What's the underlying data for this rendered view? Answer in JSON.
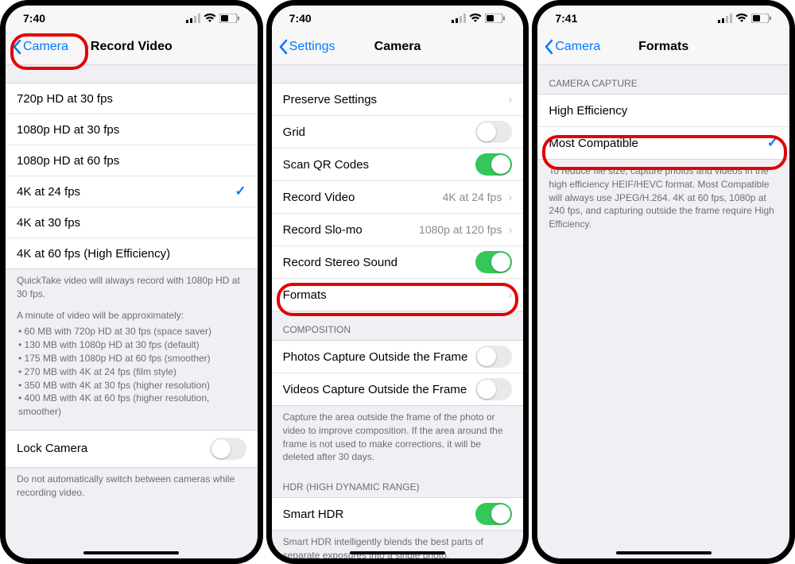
{
  "phone1": {
    "time": "7:40",
    "back": "Camera",
    "title": "Record Video",
    "options": [
      {
        "label": "720p HD at 30 fps",
        "selected": false
      },
      {
        "label": "1080p HD at 30 fps",
        "selected": false
      },
      {
        "label": "1080p HD at 60 fps",
        "selected": false
      },
      {
        "label": "4K at 24 fps",
        "selected": true
      },
      {
        "label": "4K at 30 fps",
        "selected": false
      },
      {
        "label": "4K at 60 fps (High Efficiency)",
        "selected": false
      }
    ],
    "footer_top": "QuickTake video will always record with 1080p HD at 30 fps.",
    "footer_intro": "A minute of video will be approximately:",
    "footer_bullets": [
      "60 MB with 720p HD at 30 fps (space saver)",
      "130 MB with 1080p HD at 30 fps (default)",
      "175 MB with 1080p HD at 60 fps (smoother)",
      "270 MB with 4K at 24 fps (film style)",
      "350 MB with 4K at 30 fps (higher resolution)",
      "400 MB with 4K at 60 fps (higher resolution, smoother)"
    ],
    "lock_label": "Lock Camera",
    "lock_footer": "Do not automatically switch between cameras while recording video."
  },
  "phone2": {
    "time": "7:40",
    "back": "Settings",
    "title": "Camera",
    "rows": {
      "preserve": "Preserve Settings",
      "grid": "Grid",
      "scanqr": "Scan QR Codes",
      "recvid": "Record Video",
      "recvid_val": "4K at 24 fps",
      "recslo": "Record Slo-mo",
      "recslo_val": "1080p at 120 fps",
      "stereo": "Record Stereo Sound",
      "formats": "Formats"
    },
    "composition": {
      "header": "COMPOSITION",
      "photos": "Photos Capture Outside the Frame",
      "videos": "Videos Capture Outside the Frame",
      "footer": "Capture the area outside the frame of the photo or video to improve composition. If the area around the frame is not used to make corrections, it will be deleted after 30 days."
    },
    "hdr": {
      "header": "HDR (HIGH DYNAMIC RANGE)",
      "smart": "Smart HDR",
      "footer": "Smart HDR intelligently blends the best parts of separate exposures into a single photo."
    }
  },
  "phone3": {
    "time": "7:41",
    "back": "Camera",
    "title": "Formats",
    "section_header": "CAMERA CAPTURE",
    "options": [
      {
        "label": "High Efficiency",
        "selected": false
      },
      {
        "label": "Most Compatible",
        "selected": true
      }
    ],
    "footer": "To reduce file size, capture photos and videos in the high efficiency HEIF/HEVC format. Most Compatible will always use JPEG/H.264. 4K at 60 fps, 1080p at 240 fps, and capturing outside the frame require High Efficiency."
  }
}
